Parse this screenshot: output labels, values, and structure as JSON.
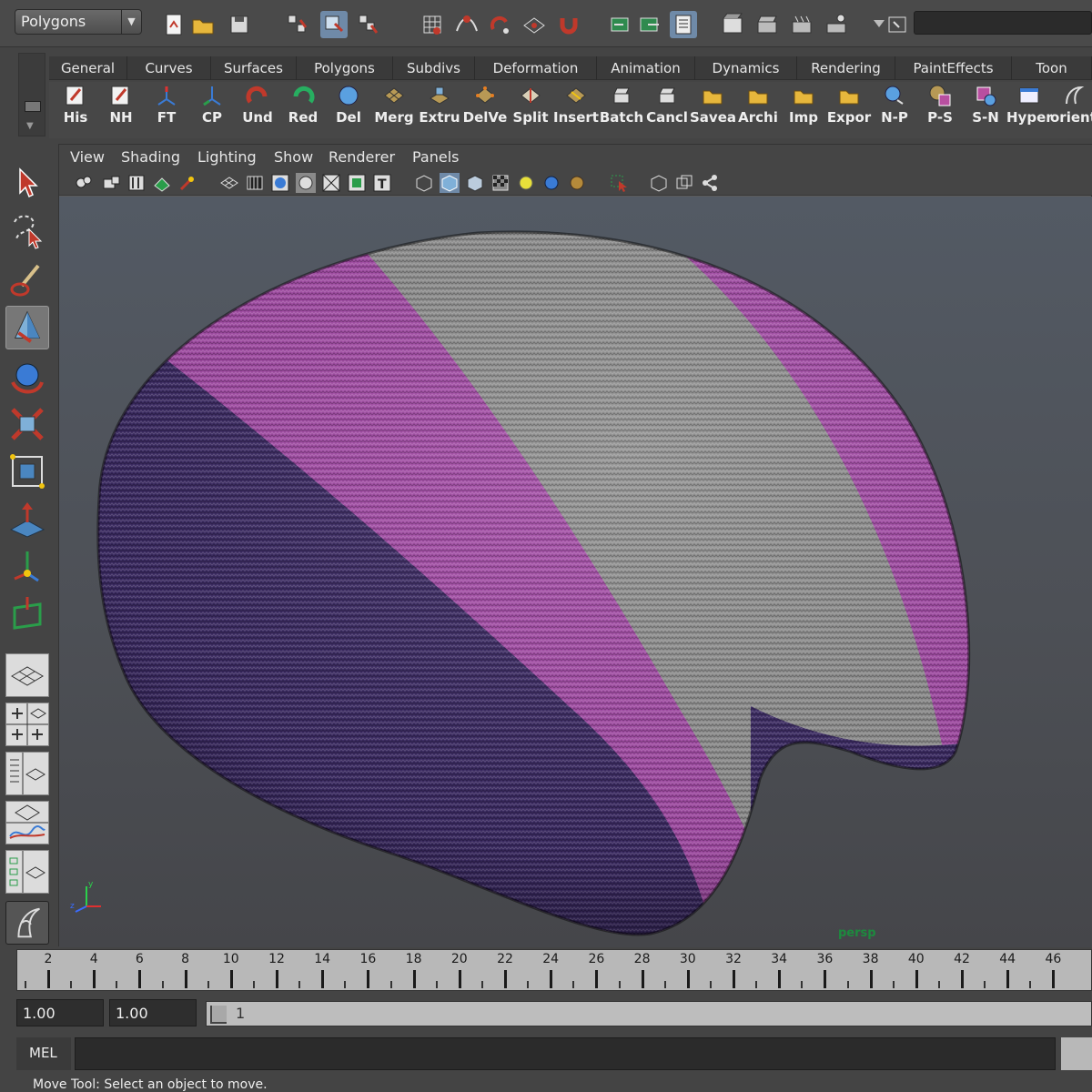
{
  "status_line": {
    "mode": "Polygons"
  },
  "shelf": {
    "tabs": [
      "General",
      "Curves",
      "Surfaces",
      "Polygons",
      "Subdivs",
      "Deformation",
      "Animation",
      "Dynamics",
      "Rendering",
      "PaintEffects",
      "Toon"
    ],
    "buttons": [
      {
        "label": "His",
        "icon": "history-icon"
      },
      {
        "label": "NH",
        "icon": "non-history-icon"
      },
      {
        "label": "FT",
        "icon": "freeze-transforms-icon"
      },
      {
        "label": "CP",
        "icon": "center-pivot-icon"
      },
      {
        "label": "Und",
        "icon": "undo-icon"
      },
      {
        "label": "Red",
        "icon": "redo-icon"
      },
      {
        "label": "Del",
        "icon": "delete-icon"
      },
      {
        "label": "Merg",
        "icon": "merge-icon"
      },
      {
        "label": "Extru",
        "icon": "extrude-icon"
      },
      {
        "label": "DelVe",
        "icon": "delete-vertex-icon"
      },
      {
        "label": "Split",
        "icon": "split-icon"
      },
      {
        "label": "Insert",
        "icon": "insert-edge-loop-icon"
      },
      {
        "label": "Batch",
        "icon": "batch-render-icon"
      },
      {
        "label": "Cancl",
        "icon": "cancel-batch-icon"
      },
      {
        "label": "Savea",
        "icon": "save-as-icon"
      },
      {
        "label": "Archi",
        "icon": "archive-icon"
      },
      {
        "label": "Imp",
        "icon": "import-icon"
      },
      {
        "label": "Expor",
        "icon": "export-icon"
      },
      {
        "label": "N-P",
        "icon": "nurbs-to-polygons-icon"
      },
      {
        "label": "P-S",
        "icon": "polygons-to-subdiv-icon"
      },
      {
        "label": "S-N",
        "icon": "subdiv-to-nurbs-icon"
      },
      {
        "label": "Hyper",
        "icon": "hypershade-icon"
      },
      {
        "label": "orient",
        "icon": "orient-icon"
      }
    ]
  },
  "panel": {
    "menus": [
      "View",
      "Shading",
      "Lighting",
      "Show",
      "Renderer",
      "Panels"
    ],
    "camera": "persp"
  },
  "time_slider": {
    "ticks": [
      "2",
      "4",
      "6",
      "8",
      "10",
      "12",
      "14",
      "16",
      "18",
      "20",
      "22",
      "24",
      "26",
      "28",
      "30",
      "32",
      "34",
      "36",
      "38",
      "40",
      "42",
      "44",
      "46"
    ]
  },
  "range_slider": {
    "start": "1.00",
    "playback_start": "1.00",
    "current": "1"
  },
  "command_line": {
    "language": "MEL"
  },
  "help_line": {
    "text": "Move Tool: Select an object to move."
  },
  "colors": {
    "accent_purple": "#a34ba6",
    "dark_purple": "#3b2a63",
    "knit_grey": "#8f8f8f",
    "camera_label": "#1d8a3e"
  }
}
